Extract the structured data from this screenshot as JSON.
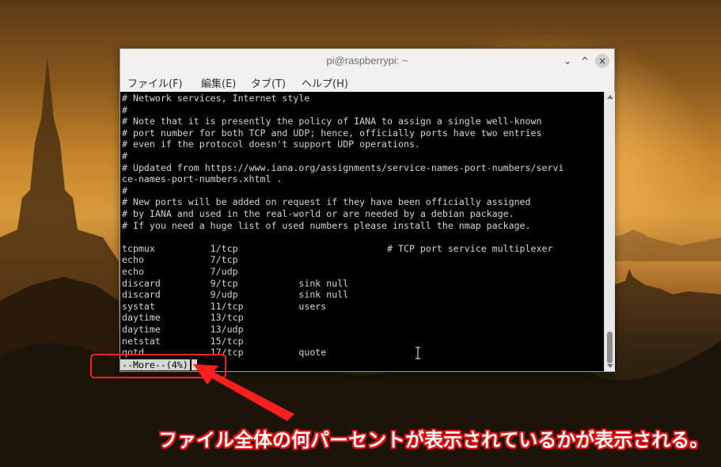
{
  "window": {
    "title": "pi@raspberrypi: ~",
    "buttons": {
      "minimize": "⌄",
      "maximize": "^",
      "close": "×"
    }
  },
  "menubar": {
    "items": [
      "ファイル(F)",
      "編集(E)",
      "タブ(T)",
      "ヘルプ(H)"
    ]
  },
  "terminal": {
    "lines": [
      "# Network services, Internet style",
      "#",
      "# Note that it is presently the policy of IANA to assign a single well-known",
      "# port number for both TCP and UDP; hence, officially ports have two entries",
      "# even if the protocol doesn't support UDP operations.",
      "#",
      "# Updated from https://www.iana.org/assignments/service-names-port-numbers/servi",
      "ce-names-port-numbers.xhtml .",
      "#",
      "# New ports will be added on request if they have been officially assigned",
      "# by IANA and used in the real-world or are needed by a debian package.",
      "# If you need a huge list of used numbers please install the nmap package.",
      "",
      "tcpmux          1/tcp                           # TCP port service multiplexer",
      "echo            7/tcp",
      "echo            7/udp",
      "discard         9/tcp           sink null",
      "discard         9/udp           sink null",
      "systat          11/tcp          users",
      "daytime         13/tcp",
      "daytime         13/udp",
      "netstat         15/tcp",
      "qotd            17/tcp          quote"
    ],
    "pager_prompt": "--More--(4%)"
  },
  "annotation": {
    "caption": "ファイル全体の何パーセントが表示されているかが表示される。",
    "accent_color": "#ff1f1f"
  }
}
